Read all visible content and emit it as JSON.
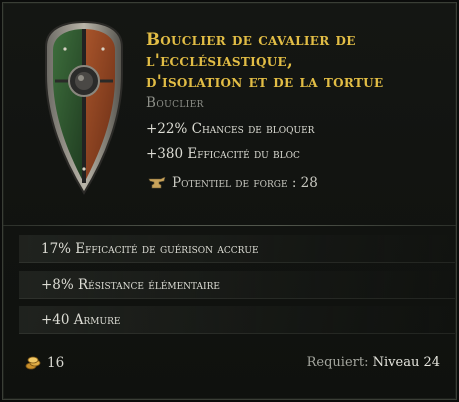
{
  "item": {
    "title": "Bouclier de cavalier de l'ecclésiastique, d'isolation et de la tortue",
    "title_lines": [
      "Bouclier de cavalier de",
      "l'ecclésiastique,",
      "d'isolation et de la tortue"
    ],
    "type": "Bouclier",
    "implicits": [
      "+22% Chances de bloquer",
      "+380 Efficacité du bloc"
    ],
    "forge_potential": "Potentiel de forge : 28",
    "affixes": [
      "17% Efficacité de guérison accrue",
      "+8% Résistance élémentaire",
      "+40 Armure"
    ],
    "gold_value": "16",
    "requirement_label": "Requiert:",
    "requirement_level": "Niveau 24"
  },
  "icons": {
    "item_image": "kite-shield-icon",
    "forge": "anvil-icon",
    "gold": "gold-coins-icon"
  },
  "colors": {
    "title": "#e2bd45",
    "type": "#8d8f88",
    "text": "#dcdcd4"
  }
}
